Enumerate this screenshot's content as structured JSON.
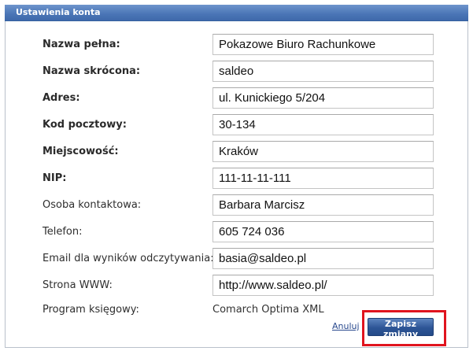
{
  "panel": {
    "title": "Ustawienia konta"
  },
  "form": {
    "fields": [
      {
        "label": "Nazwa pełna:",
        "value": "Pokazowe Biuro Rachunkowe"
      },
      {
        "label": "Nazwa skrócona:",
        "value": "saldeo"
      },
      {
        "label": "Adres:",
        "value": "ul. Kunickiego 5/204"
      },
      {
        "label": "Kod pocztowy:",
        "value": "30-134"
      },
      {
        "label": "Miejscowość:",
        "value": "Kraków"
      },
      {
        "label": "NIP:",
        "value": "111-11-11-111"
      },
      {
        "label": "Osoba kontaktowa:",
        "value": "Barbara Marcisz"
      },
      {
        "label": "Telefon:",
        "value": "605 724 036"
      },
      {
        "label": "Email dla wyników odczytywania:",
        "value": "basia@saldeo.pl"
      },
      {
        "label": "Strona WWW:",
        "value": "http://www.saldeo.pl/"
      }
    ],
    "program": {
      "label": "Program księgowy:",
      "value": "Comarch Optima XML"
    }
  },
  "actions": {
    "cancel_label": "Anuluj",
    "save_label": "Zapisz zmiany"
  },
  "colors": {
    "header": "#4a75b6",
    "highlight": "#e0141e",
    "button": "#2d5596"
  }
}
